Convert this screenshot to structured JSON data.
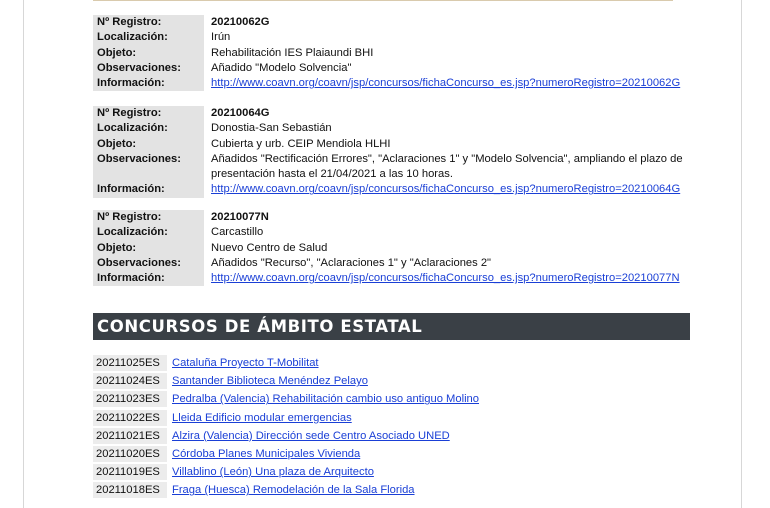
{
  "labels": {
    "registro": "Nº Registro:",
    "localizacion": "Localización:",
    "objeto": "Objeto:",
    "observaciones": "Observaciones:",
    "informacion": "Información:"
  },
  "entries": [
    {
      "registro": "20210062G",
      "localizacion": "Irún",
      "objeto": "Rehabilitación IES Plaiaundi BHI",
      "observaciones": "Añadido \"Modelo Solvencia\"",
      "informacion": "http://www.coavn.org/coavn/jsp/concursos/fichaConcurso_es.jsp?numeroRegistro=20210062G"
    },
    {
      "registro": "20210064G",
      "localizacion": "Donostia-San Sebastián",
      "objeto": "Cubierta y urb. CEIP Mendiola HLHI",
      "observaciones": "Añadidos \"Rectificación Errores\", \"Aclaraciones 1\" y \"Modelo Solvencia\", ampliando el plazo de presentación hasta el 21/04/2021 a las 10 horas.",
      "informacion": "http://www.coavn.org/coavn/jsp/concursos/fichaConcurso_es.jsp?numeroRegistro=20210064G"
    },
    {
      "registro": "20210077N",
      "localizacion": "Carcastillo",
      "objeto": "Nuevo Centro de Salud",
      "observaciones": "Añadidos \"Recurso\",  \"Aclaraciones 1\" y \"Aclaraciones 2\"",
      "informacion": "http://www.coavn.org/coavn/jsp/concursos/fichaConcurso_es.jsp?numeroRegistro=20210077N"
    }
  ],
  "banner_title": "CONCURSOS DE ÁMBITO ESTATAL",
  "estatal": [
    {
      "code": "20211025ES",
      "title": "Cataluña Proyecto T-Mobilitat"
    },
    {
      "code": "20211024ES",
      "title": "Santander Biblioteca Menéndez Pelayo"
    },
    {
      "code": "20211023ES",
      "title": "Pedralba (Valencia) Rehabilitación cambio uso antiguo Molino"
    },
    {
      "code": "20211022ES",
      "title": "Lleida Edificio modular emergencias"
    },
    {
      "code": "20211021ES",
      "title": "Alzira (Valencia) Dirección sede Centro Asociado UNED"
    },
    {
      "code": "20211020ES",
      "title": "Córdoba Planes Municipales Vivienda"
    },
    {
      "code": "20211019ES",
      "title": "Villablino (León) Una plaza de Arquitecto"
    },
    {
      "code": "20211018ES",
      "title": "Fraga (Huesca) Remodelación de la Sala Florida"
    }
  ],
  "colors": {
    "link": "#1a3fd6",
    "banner_bg": "#3a4046",
    "label_bg": "#e3e3e3"
  }
}
